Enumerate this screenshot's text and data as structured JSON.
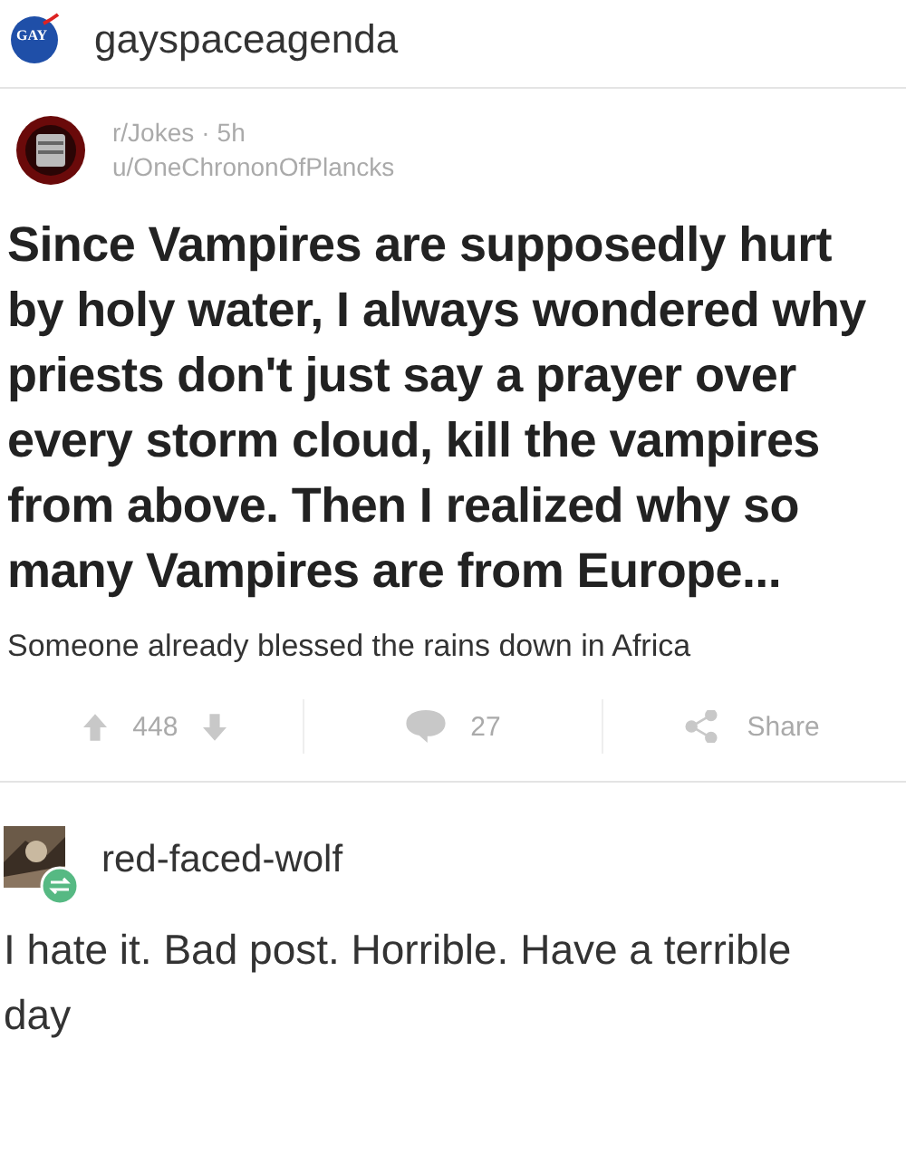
{
  "post": {
    "author": "gayspaceagenda",
    "avatar_label": "GAY"
  },
  "reddit": {
    "subreddit": "r/Jokes",
    "separator": "·",
    "age": "5h",
    "user": "u/OneChrononOfPlancks",
    "title": "Since Vampires are supposedly hurt by holy water, I always wondered why priests don't just say a prayer over every storm cloud, kill the vampires from above. Then I realized why so many Vampires are from Europe...",
    "body": "Someone already blessed the rains down in Africa",
    "score": "448",
    "comments": "27",
    "share": "Share"
  },
  "reblog": {
    "author": "red-faced-wolf",
    "text": "I hate it. Bad post. Horrible. Have a terrible day"
  }
}
